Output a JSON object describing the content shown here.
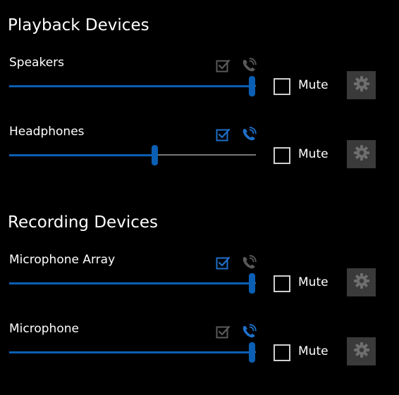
{
  "colors": {
    "accent": "#1e6fc8",
    "inactive_icon": "#5a5a5a",
    "track": "#767676",
    "button_bg": "#3a3a3a",
    "gear": "#6e6e6e"
  },
  "playback": {
    "title": "Playback Devices",
    "devices": [
      {
        "name": "Speakers",
        "volume_percent": 100,
        "is_default": false,
        "is_default_communication": false,
        "mute_label": "Mute",
        "muted": false
      },
      {
        "name": "Headphones",
        "volume_percent": 60,
        "is_default": true,
        "is_default_communication": true,
        "mute_label": "Mute",
        "muted": false
      }
    ]
  },
  "recording": {
    "title": "Recording Devices",
    "devices": [
      {
        "name": "Microphone Array",
        "volume_percent": 100,
        "is_default": true,
        "is_default_communication": false,
        "mute_label": "Mute",
        "muted": false
      },
      {
        "name": "Microphone",
        "volume_percent": 100,
        "is_default": false,
        "is_default_communication": true,
        "mute_label": "Mute",
        "muted": false
      }
    ]
  },
  "icons": {
    "default_device": "check-box-icon",
    "default_communication": "phone-icon",
    "settings": "gear-icon"
  }
}
